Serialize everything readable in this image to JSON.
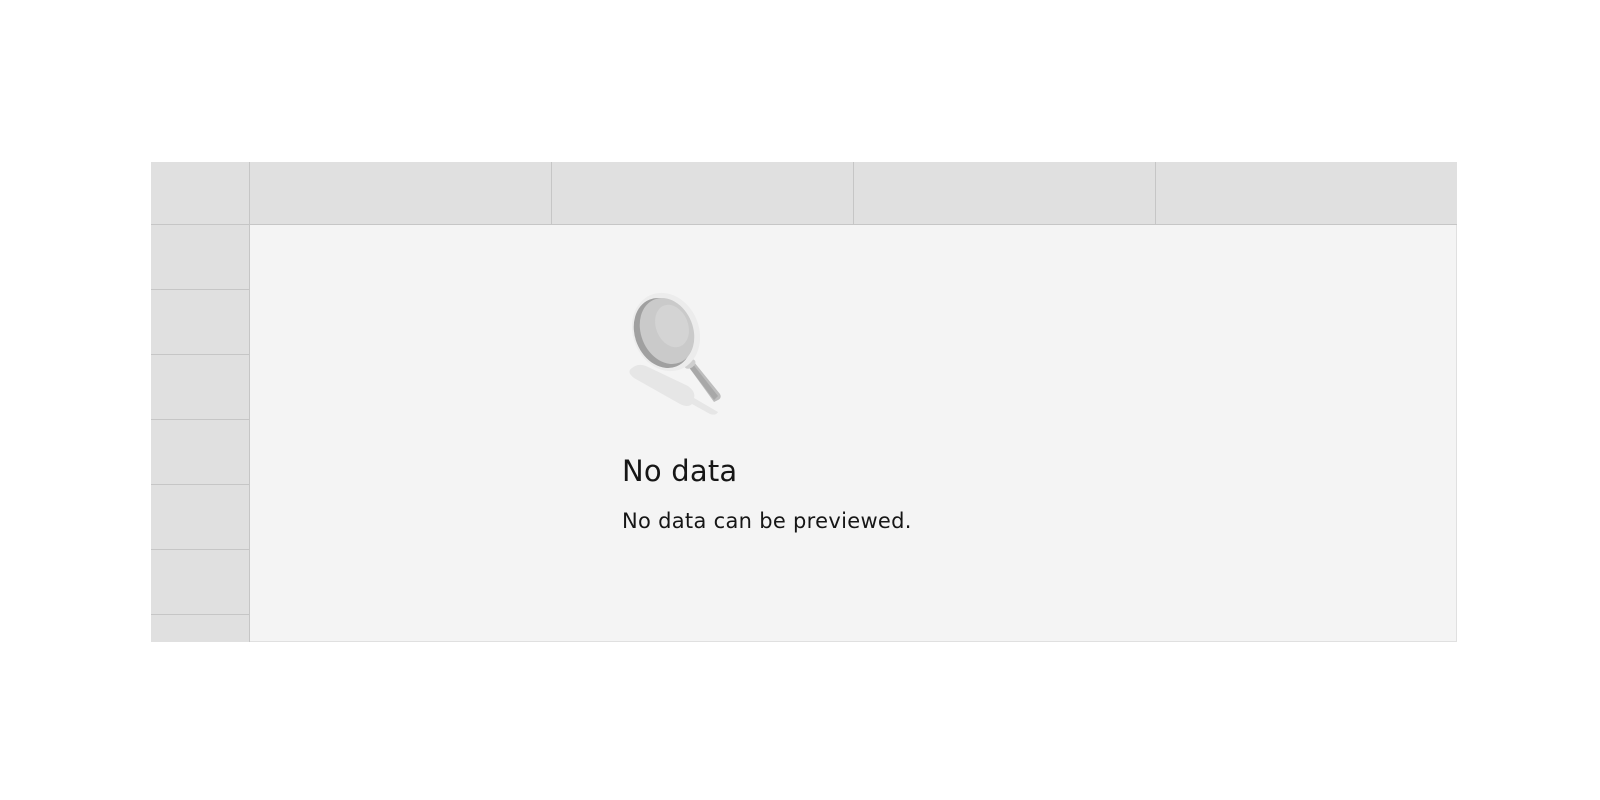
{
  "grid": {
    "column_headers": [
      "",
      "",
      "",
      ""
    ],
    "row_headers": [
      "",
      "",
      "",
      "",
      "",
      "",
      ""
    ]
  },
  "empty_state": {
    "title": "No data",
    "subtitle": "No data can be previewed.",
    "icon": "magnifying-glass-icon"
  },
  "colors": {
    "header_fill": "#e0e0e0",
    "header_border": "#c6c6c6",
    "body_fill": "#f4f4f4",
    "text": "#161616"
  }
}
